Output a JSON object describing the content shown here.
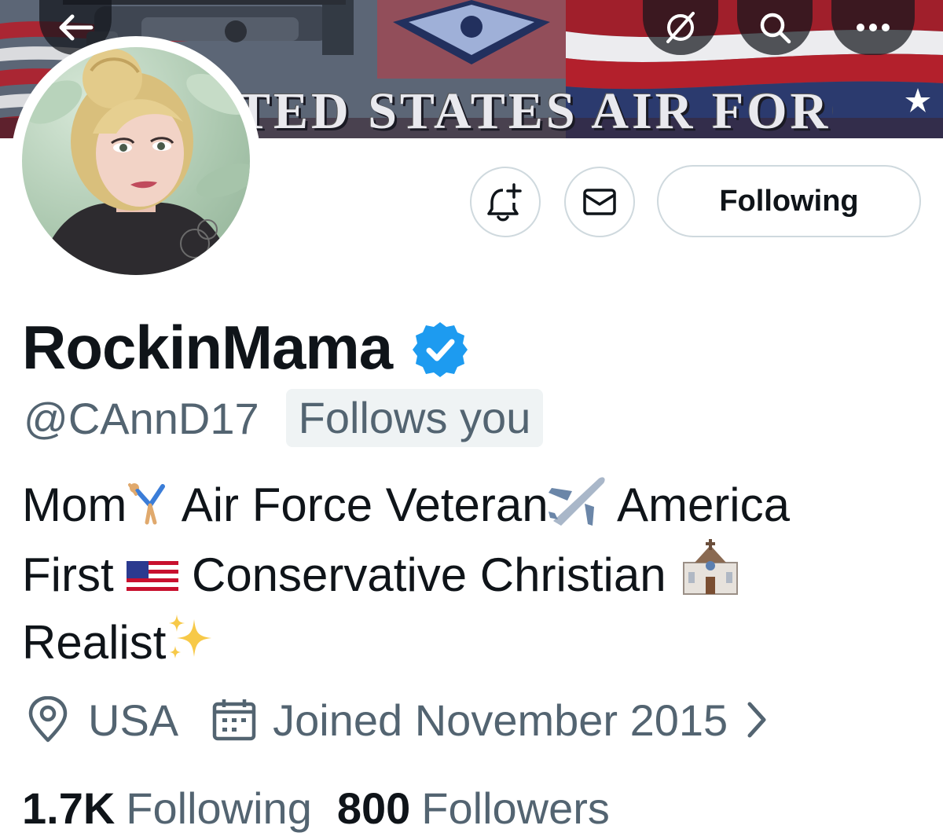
{
  "banner": {
    "text": "TED STATES AIR FORCE"
  },
  "nav": {
    "back_icon": "arrow-left-icon",
    "alt_icon": "no-symbol-icon",
    "search_icon": "search-icon",
    "more_icon": "more-dots-icon"
  },
  "actions": {
    "notify_icon": "bell-plus-icon",
    "message_icon": "envelope-icon",
    "follow_label": "Following"
  },
  "profile": {
    "display_name": "RockinMama",
    "verified_icon": "verified-badge-icon",
    "handle": "@CAnnD17",
    "follows_you": "Follows you",
    "bio": {
      "line1_a": "Mom",
      "line1_b": " Air Force Veteran",
      "line1_c": " America",
      "line2_a": "First ",
      "line2_b": " Conservative Christian ",
      "line3_a": "Realist"
    },
    "location": "USA",
    "joined": "Joined November 2015",
    "following_count": "1.7K",
    "following_label": "Following",
    "followers_count": "800",
    "followers_label": "Followers"
  },
  "colors": {
    "text_primary": "#0f1419",
    "text_secondary": "#536471",
    "verified_blue": "#1d9bf0",
    "border": "#cfd9de"
  }
}
